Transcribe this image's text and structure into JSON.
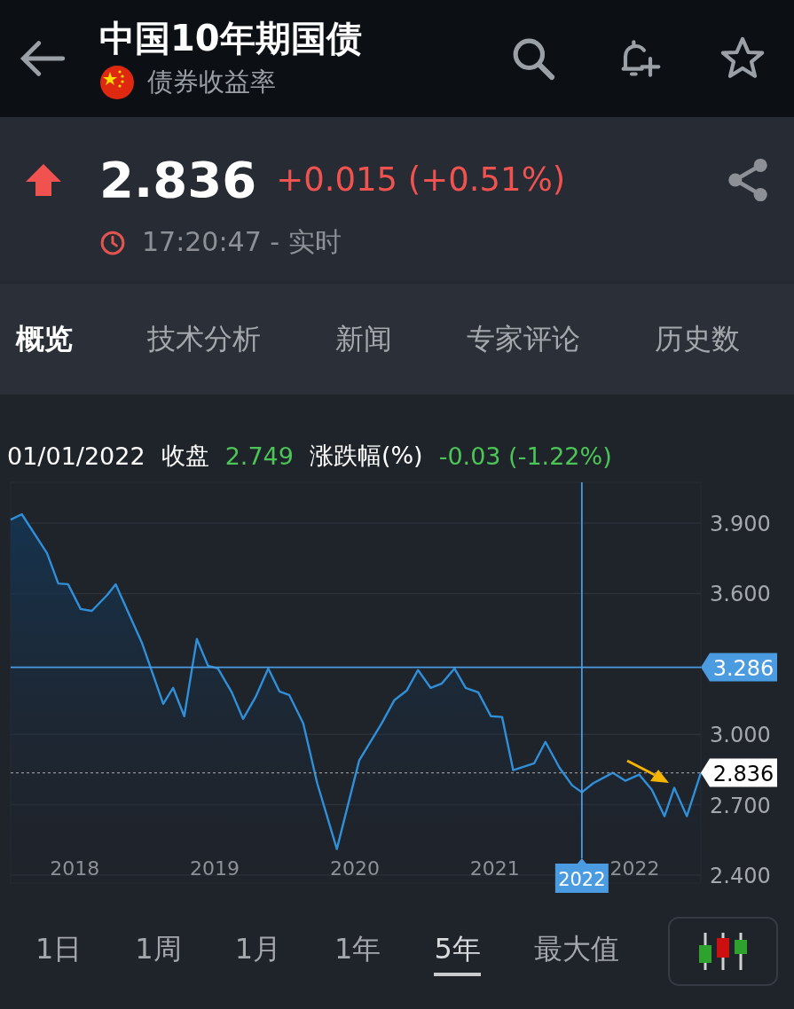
{
  "header": {
    "title": "中国10年期国债",
    "subtitle": "债券收益率"
  },
  "quote": {
    "price": "2.836",
    "change": "+0.015 (+0.51%)",
    "up": true,
    "time": "17:20:47 - 实时"
  },
  "tabs": [
    {
      "label": "概览",
      "selected": true
    },
    {
      "label": "技术分析",
      "selected": false
    },
    {
      "label": "新闻",
      "selected": false
    },
    {
      "label": "专家评论",
      "selected": false
    },
    {
      "label": "历史数",
      "selected": false
    }
  ],
  "chart_info": {
    "date": "01/01/2022",
    "close_label": "收盘",
    "close": "2.749",
    "change_label": "涨跌幅(%)",
    "change": "-0.03 (-1.22%)"
  },
  "chart": {
    "chart_data": {
      "type": "area",
      "x": [
        2017.58,
        2017.66,
        2017.84,
        2017.92,
        2017.99,
        2018.08,
        2018.16,
        2018.27,
        2018.33,
        2018.39,
        2018.52,
        2018.67,
        2018.74,
        2018.82,
        2018.91,
        2018.99,
        2019.06,
        2019.16,
        2019.24,
        2019.33,
        2019.42,
        2019.5,
        2019.57,
        2019.67,
        2019.77,
        2019.91,
        2020.07,
        2020.23,
        2020.32,
        2020.41,
        2020.49,
        2020.58,
        2020.66,
        2020.75,
        2020.83,
        2020.92,
        2021.01,
        2021.09,
        2021.17,
        2021.32,
        2021.4,
        2021.5,
        2021.59,
        2021.66,
        2021.74,
        2021.88,
        2021.97,
        2022.07,
        2022.16,
        2022.25,
        2022.32,
        2022.41,
        2022.51
      ],
      "series": [
        {
          "color": "#2f8fd8",
          "values": [
            3.915,
            3.938,
            3.772,
            3.643,
            3.64,
            3.534,
            3.526,
            3.594,
            3.64,
            3.56,
            3.387,
            3.13,
            3.198,
            3.077,
            3.406,
            3.292,
            3.281,
            3.179,
            3.066,
            3.16,
            3.281,
            3.183,
            3.168,
            3.047,
            2.791,
            2.511,
            2.889,
            3.047,
            3.145,
            3.187,
            3.274,
            3.198,
            3.217,
            3.281,
            3.198,
            3.179,
            3.077,
            3.074,
            2.847,
            2.877,
            2.968,
            2.858,
            2.783,
            2.753,
            2.791,
            2.836,
            2.802,
            2.828,
            2.764,
            2.651,
            2.772,
            2.651,
            2.836
          ]
        }
      ],
      "xlim": [
        2017.58,
        2022.51
      ],
      "ylim": [
        2.366,
        4.074
      ],
      "xticks": [
        2018,
        2019,
        2020,
        2021,
        2022
      ],
      "yticks": [
        {
          "value": 3.9,
          "label": "3.900"
        },
        {
          "value": 3.6,
          "label": "3.600"
        },
        {
          "value": 3.0,
          "label": "3.000"
        },
        {
          "value": 2.7,
          "label": "2.700"
        },
        {
          "value": 2.4,
          "label": "2.400"
        }
      ],
      "grid": true,
      "ref_lines": [
        {
          "axis": "y",
          "value": 3.286,
          "label": "3.286",
          "color": "#4a9be0"
        },
        {
          "axis": "x",
          "value": 2021.66,
          "label": "2022",
          "color": "#4a9be0"
        },
        {
          "axis": "y",
          "value": 2.836,
          "label": "2.836",
          "color": "#8d9197"
        }
      ]
    }
  },
  "ranges": [
    {
      "label": "1日",
      "selected": false
    },
    {
      "label": "1周",
      "selected": false
    },
    {
      "label": "1月",
      "selected": false
    },
    {
      "label": "1年",
      "selected": false
    },
    {
      "label": "5年",
      "selected": true
    },
    {
      "label": "最大值",
      "selected": false
    }
  ]
}
